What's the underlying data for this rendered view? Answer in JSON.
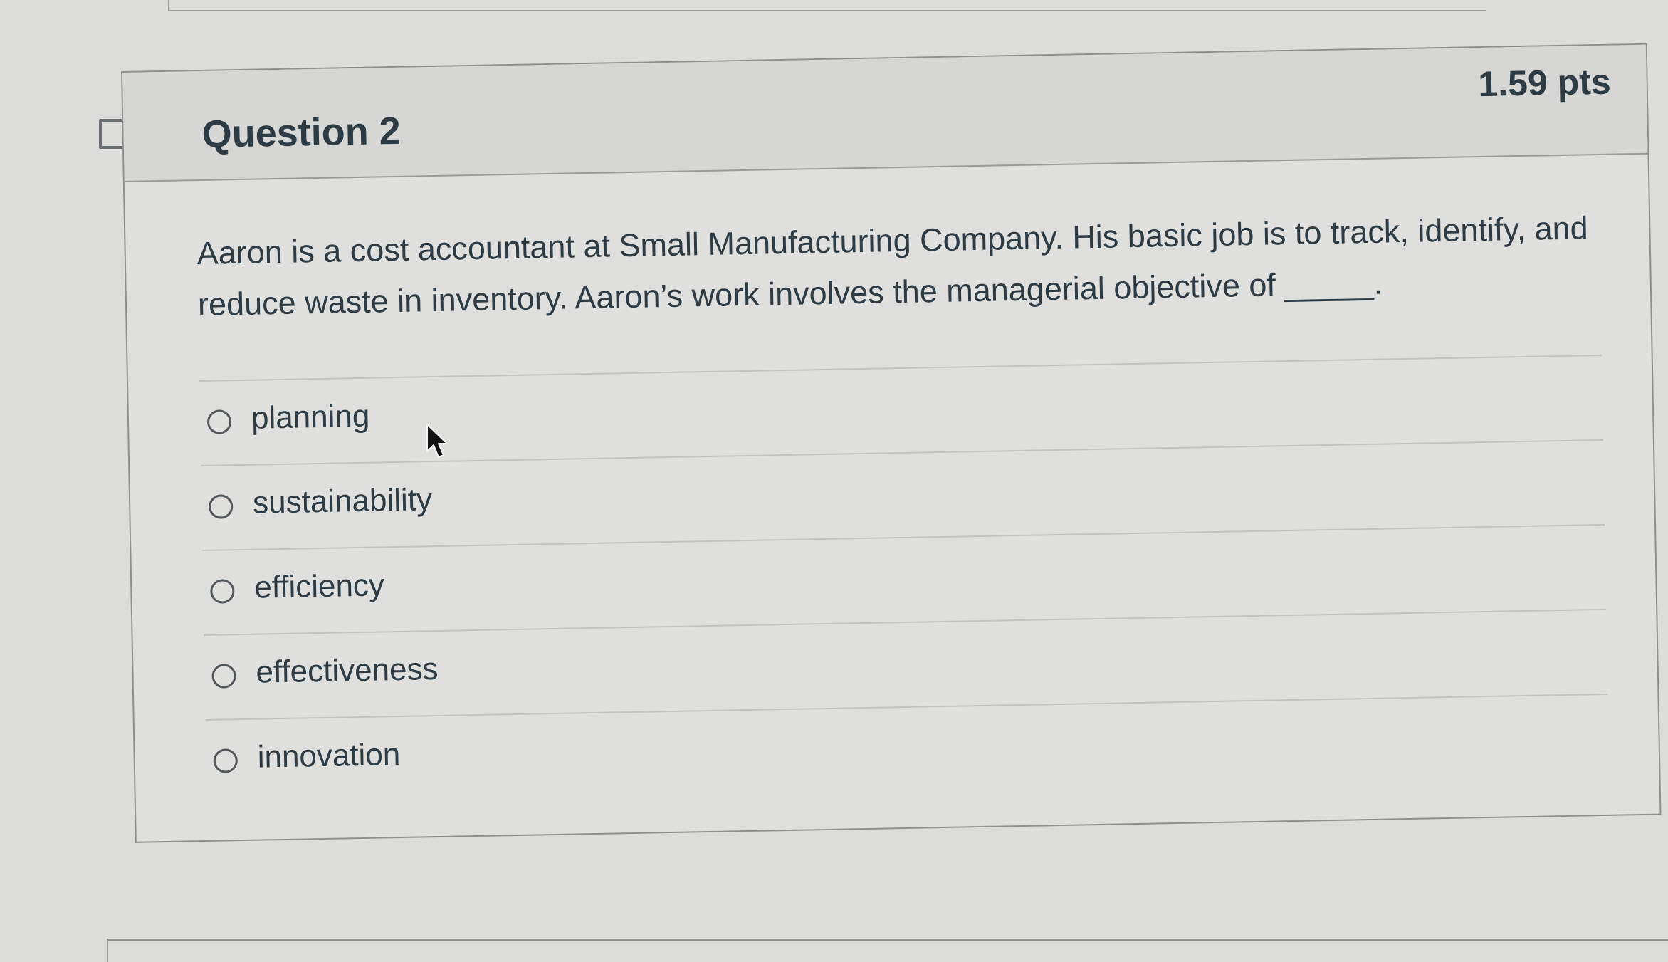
{
  "question": {
    "title": "Question 2",
    "points": "1.59 pts",
    "text": "Aaron is a cost accountant at Small Manufacturing Company. His basic job is to track, identify, and reduce waste in inventory. Aaron’s work involves the managerial objective of _____.",
    "answers": [
      {
        "label": "planning"
      },
      {
        "label": "sustainability"
      },
      {
        "label": "efficiency"
      },
      {
        "label": "effectiveness"
      },
      {
        "label": "innovation"
      }
    ]
  },
  "icons": {
    "flag": "flag-question-icon",
    "cursor": "mouse-pointer-icon"
  },
  "colors": {
    "text": "#2d3b45",
    "background": "#dcdcda",
    "card_border": "#8f8f8d"
  }
}
